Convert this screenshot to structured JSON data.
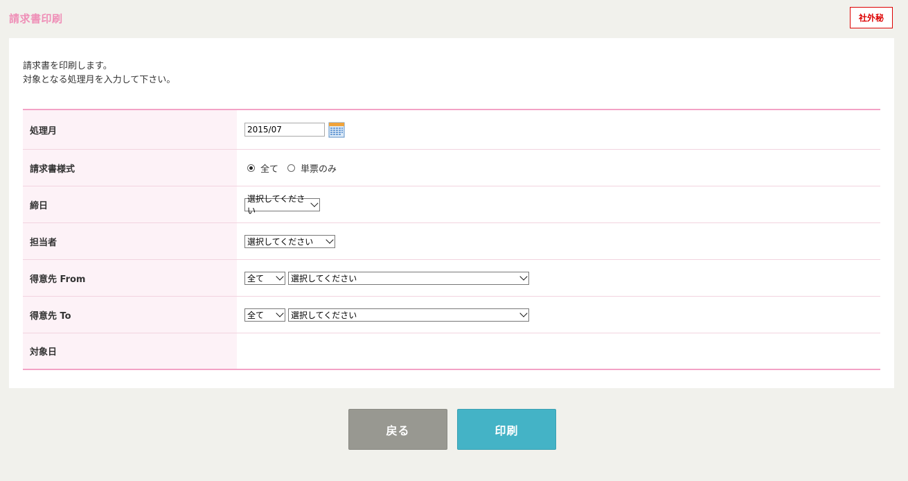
{
  "header": {
    "title": "請求書印刷",
    "badge": "社外秘"
  },
  "intro": {
    "line1": "請求書を印刷します。",
    "line2": "対象となる処理月を入力して下さい。"
  },
  "form": {
    "processing_month": {
      "label": "処理月",
      "value": "2015/07",
      "icon": "calendar-icon"
    },
    "invoice_style": {
      "label": "請求書様式",
      "options": [
        {
          "label": "全て",
          "checked": true
        },
        {
          "label": "単票のみ",
          "checked": false
        }
      ]
    },
    "closing_day": {
      "label": "締日",
      "selected": "選択してください"
    },
    "staff": {
      "label": "担当者",
      "selected": "選択してください"
    },
    "customer_from": {
      "label": "得意先 From",
      "type_selected": "全て",
      "selected": "選択してください"
    },
    "customer_to": {
      "label": "得意先 To",
      "type_selected": "全て",
      "selected": "選択してください"
    },
    "target_date": {
      "label": "対象日"
    }
  },
  "buttons": {
    "back": "戻る",
    "print": "印刷"
  },
  "colors": {
    "accent_pink": "#ef8fb7",
    "confidential_red": "#dd0000",
    "print_button": "#44b3c6",
    "back_button": "#989891"
  }
}
